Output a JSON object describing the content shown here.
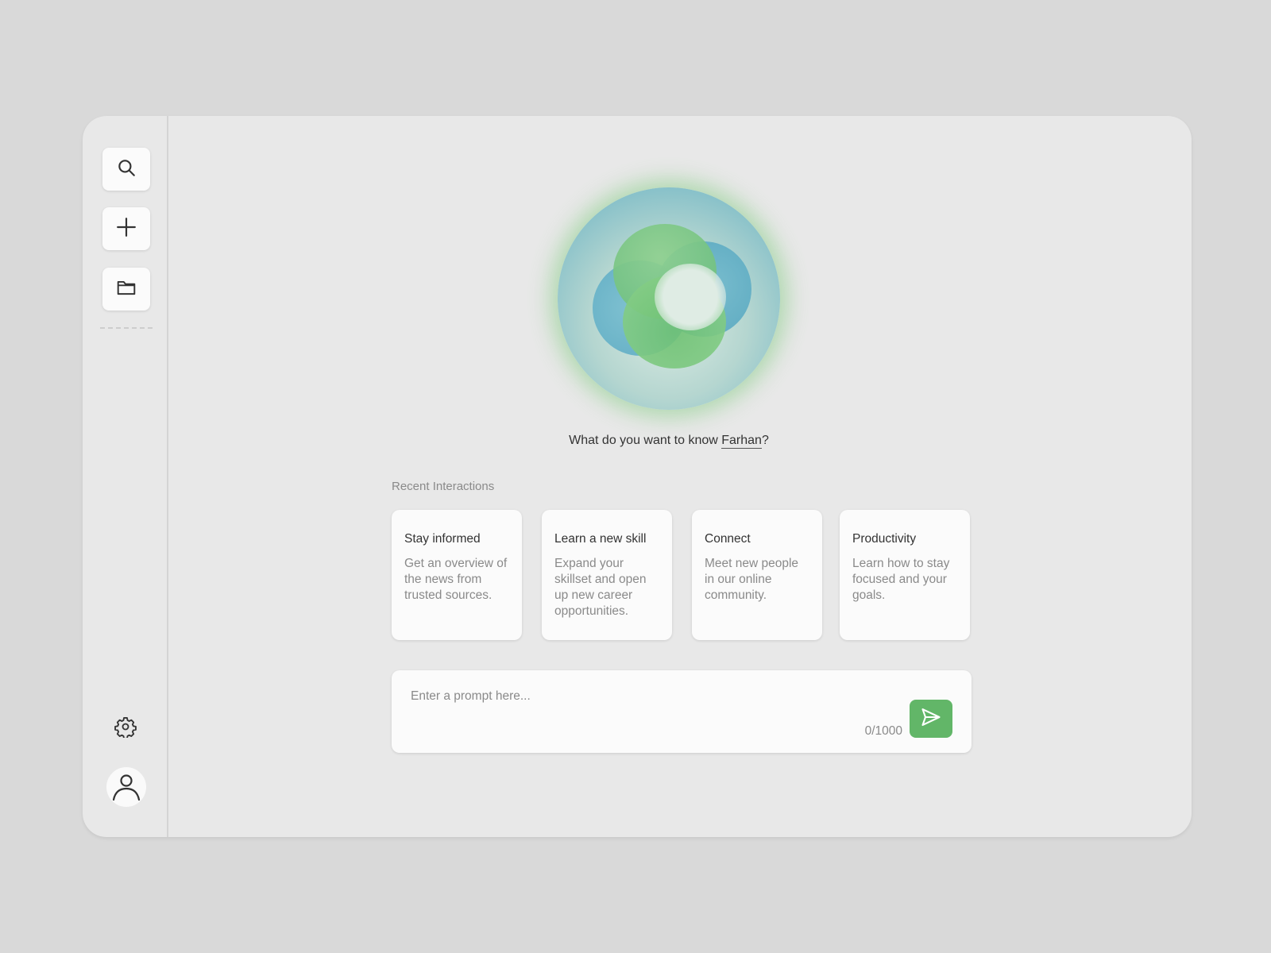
{
  "sidebar": {
    "top_buttons": [
      {
        "icon": "search-icon"
      },
      {
        "icon": "plus-icon"
      },
      {
        "icon": "folder-icon"
      }
    ],
    "bottom": {
      "settings_icon": "gear-icon",
      "avatar_icon": "user-icon"
    }
  },
  "greeting": {
    "prefix": "What do you want to know ",
    "name": "Farhan",
    "suffix": "?"
  },
  "recent": {
    "label": "Recent Interactions",
    "cards": [
      {
        "title": "Stay informed",
        "description": "Get an overview of the news from trusted sources."
      },
      {
        "title": "Learn a new skill",
        "description": "Expand your skillset and open up new career opportunities."
      },
      {
        "title": "Connect",
        "description": "Meet new people in our online community."
      },
      {
        "title": "Productivity",
        "description": "Learn how to stay focused and your goals."
      }
    ]
  },
  "prompt": {
    "placeholder": "Enter a prompt here...",
    "value": "",
    "counter": "0/1000",
    "send_icon": "send-icon"
  },
  "colors": {
    "accent": "#62b668",
    "window_bg": "#e8e8e8",
    "page_bg": "#d9d9d9",
    "card_bg": "#fbfbfb"
  }
}
